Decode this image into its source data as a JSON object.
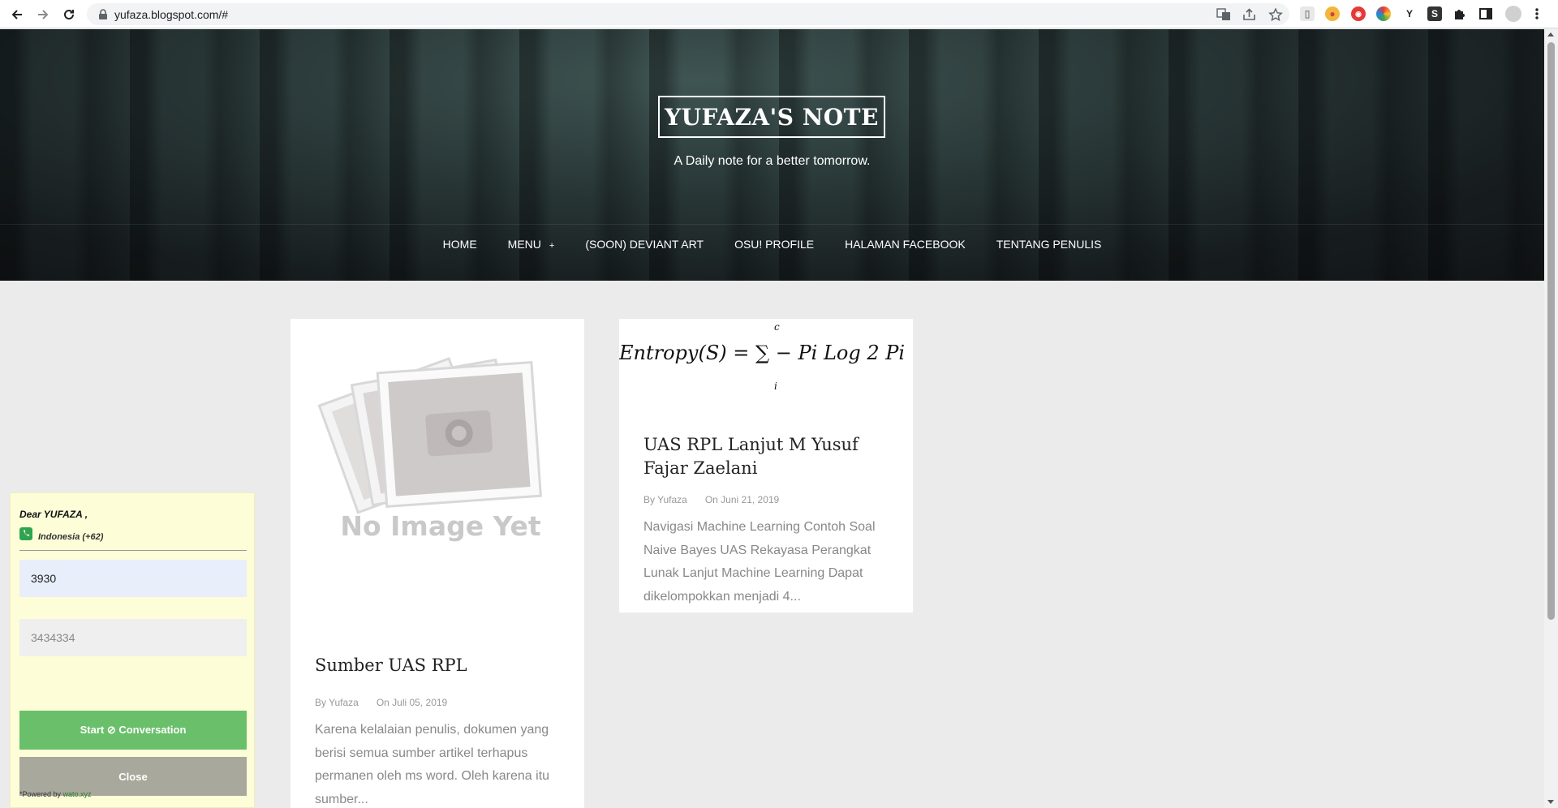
{
  "browser": {
    "url": "yufaza.blogspot.com/#"
  },
  "site": {
    "title": "YUFAZA'S NOTE",
    "tagline": "A Daily note for a better tomorrow."
  },
  "menu": [
    {
      "label": "HOME"
    },
    {
      "label": "MENU",
      "has_submenu": true,
      "submenu_marker": "+"
    },
    {
      "label": "(SOON) DEVIANT ART"
    },
    {
      "label": "OSU! PROFILE"
    },
    {
      "label": "HALAMAN FACEBOOK"
    },
    {
      "label": "TENTANG PENULIS"
    }
  ],
  "posts": [
    {
      "image_text": "No Image Yet",
      "title": "Sumber UAS RPL",
      "author": "By Yufaza",
      "date": "On Juli 05, 2019",
      "excerpt": "Karena kelalaian penulis, dokumen yang berisi semua sumber artikel terhapus permanen oleh ms word. Oleh karena itu sumber..."
    },
    {
      "image_formula": "Entropy(S) = ∑ − Pi Log 2 Pi",
      "formula_upper": "c",
      "formula_lower": "i",
      "title": "UAS RPL Lanjut M Yusuf Fajar Zaelani",
      "author": "By Yufaza",
      "date": "On Juni 21, 2019",
      "excerpt": "Navigasi Machine Learning Contoh Soal Naive Bayes UAS Rekayasa Perangkat Lunak Lanjut Machine Learning Dapat dikelompokkan menjadi 4..."
    }
  ],
  "chat_widget": {
    "greeting": "Dear YUFAZA ,",
    "country": "Indonesia (+62)",
    "phone_value": "3930",
    "phone_placeholder": "3434334",
    "start_label": "Start ⊘ Conversation",
    "close_label": "Close",
    "powered_prefix": "*Powered by ",
    "powered_link": "wato.xyz"
  },
  "colors": {
    "widget_bg": "#fdfdd8",
    "start_btn": "#6abf6a",
    "close_btn": "#a8a89c"
  }
}
